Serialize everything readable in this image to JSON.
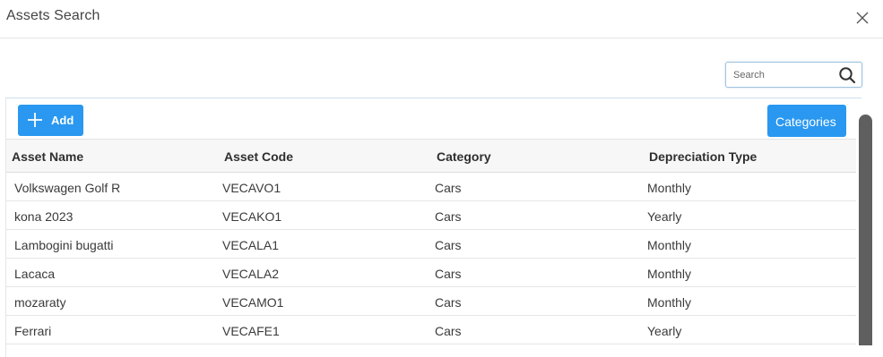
{
  "dialog": {
    "title": "Assets Search"
  },
  "search": {
    "placeholder": "Search",
    "value": ""
  },
  "toolbar": {
    "add_label": "Add",
    "categories_label": "Categories"
  },
  "table": {
    "columns": [
      "Asset Name",
      "Asset Code",
      "Category",
      "Depreciation Type"
    ],
    "rows": [
      [
        "Volkswagen Golf R",
        "VECAVO1",
        "Cars",
        "Monthly"
      ],
      [
        "kona 2023",
        "VECAKO1",
        "Cars",
        "Yearly"
      ],
      [
        "Lambogini bugatti",
        "VECALA1",
        "Cars",
        "Monthly"
      ],
      [
        "Lacaca",
        "VECALA2",
        "Cars",
        "Monthly"
      ],
      [
        "mozaraty",
        "VECAMO1",
        "Cars",
        "Monthly"
      ],
      [
        "Ferrari",
        "VECAFE1",
        "Cars",
        "Yearly"
      ]
    ]
  },
  "colors": {
    "accent": "#2a98f0",
    "scrollbar": "#5f5f5f"
  },
  "icons": {
    "close": "close-icon",
    "search": "search-icon",
    "add": "plus-icon"
  }
}
